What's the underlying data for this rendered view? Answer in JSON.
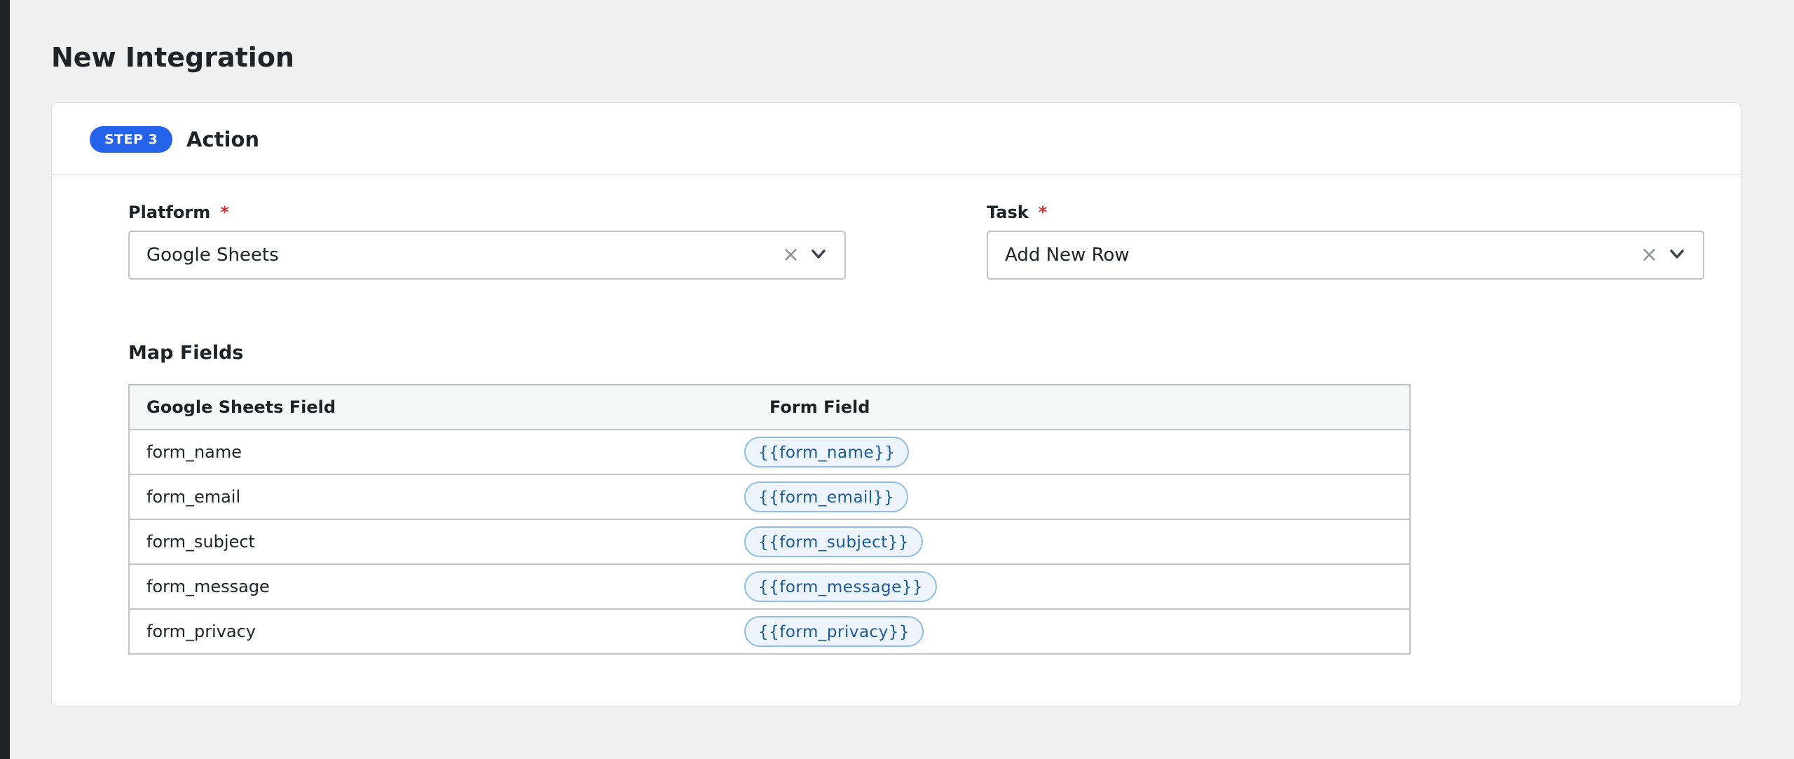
{
  "page": {
    "title": "New Integration"
  },
  "step": {
    "badge": "STEP 3",
    "title": "Action"
  },
  "platform": {
    "label": "Platform",
    "required_mark": "*",
    "value": "Google Sheets",
    "clear_glyph": "×"
  },
  "task": {
    "label": "Task",
    "required_mark": "*",
    "value": "Add New Row",
    "clear_glyph": "×"
  },
  "map": {
    "title": "Map Fields",
    "headers": [
      "Google Sheets Field",
      "Form Field"
    ],
    "rows": [
      {
        "field": "form_name",
        "token": "{{form_name}}"
      },
      {
        "field": "form_email",
        "token": "{{form_email}}"
      },
      {
        "field": "form_subject",
        "token": "{{form_subject}}"
      },
      {
        "field": "form_message",
        "token": "{{form_message}}"
      },
      {
        "field": "form_privacy",
        "token": "{{form_privacy}}"
      }
    ]
  },
  "colors": {
    "accent": "#2563eb",
    "required": "#d63638",
    "token_bg": "#eef4fb",
    "token_border": "#8fbcea",
    "token_text": "#1a5a96"
  }
}
